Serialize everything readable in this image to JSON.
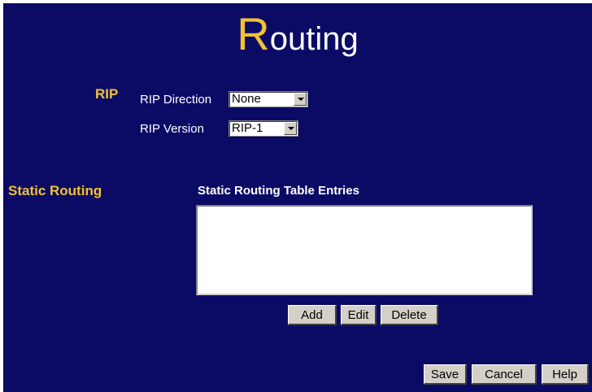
{
  "page": {
    "title_initial": "R",
    "title_rest": "outing"
  },
  "rip": {
    "section_label": "RIP",
    "direction_label": "RIP Direction",
    "direction_value": "None",
    "version_label": "RIP Version",
    "version_value": "RIP-1"
  },
  "static_routing": {
    "section_label": "Static Routing",
    "table_heading": "Static Routing Table Entries",
    "entries": [],
    "add_label": "Add",
    "edit_label": "Edit",
    "delete_label": "Delete"
  },
  "footer": {
    "save_label": "Save",
    "cancel_label": "Cancel",
    "help_label": "Help"
  },
  "colors": {
    "background": "#0b0b66",
    "accent": "#f2c230",
    "text": "#ffffff"
  }
}
